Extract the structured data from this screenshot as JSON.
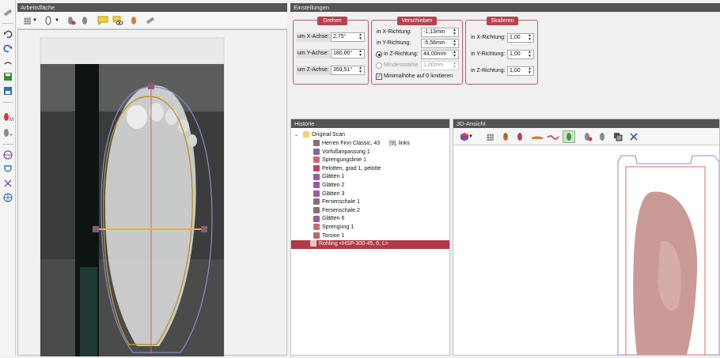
{
  "left_toolbar": {
    "icons": [
      "ruler-icon",
      "undo-icon",
      "redo-icon",
      "rotate-icon",
      "save-icon",
      "export-icon",
      "foot-m-icon",
      "foot-plus-icon",
      "compass-icon",
      "shield-icon",
      "cross-icon",
      "grid-icon"
    ],
    "foot_m_label": "M"
  },
  "workspace": {
    "title": "Arbeitsfläche",
    "toolbar": [
      "grid-icon",
      "foot-outline-icon",
      "foot-red-icon",
      "foot-gray-icon",
      "comment-icon",
      "eye-comment-icon",
      "foot-orange-icon",
      "ruler-icon"
    ]
  },
  "settings": {
    "title": "Einstellungen",
    "drehen": {
      "title": "Drehen",
      "rows": [
        {
          "label": "um X-Achse:",
          "value": "2,75°"
        },
        {
          "label": "um Y-Achse:",
          "value": "180,00°"
        },
        {
          "label": "um Z-Achse:",
          "value": "359,51°"
        }
      ]
    },
    "verschieben": {
      "title": "Verschieben",
      "rows": [
        {
          "label": "in X-Richtung:",
          "value": "-1,13mm"
        },
        {
          "label": "in Y-Richtung:",
          "value": "-5,56mm"
        },
        {
          "label": "in Z-Richtung:",
          "value": "44,00mm"
        },
        {
          "label": "Mindeststärke",
          "value": "1,00mm"
        }
      ],
      "checkbox": "Minimalhöhe auf 0 limitieren"
    },
    "skalieren": {
      "title": "Skalieren",
      "rows": [
        {
          "label": "in X-Richtung:",
          "value": "1,00"
        },
        {
          "label": "in Y-Richtung:",
          "value": "1,00"
        },
        {
          "label": "in Z-Richtung:",
          "value": "1,00"
        }
      ]
    }
  },
  "history": {
    "title": "Historie",
    "root": "Original Scan",
    "items": [
      {
        "text": "Herren Finn Classic, 43",
        "extra": "[9], links",
        "color": "#8a6f6f"
      },
      {
        "text": "Vorfußanpassung 1",
        "color": "#7a6aa8"
      },
      {
        "text": "Sprengungslinie 1",
        "color": "#c46a7a"
      },
      {
        "text": "Pelotten, grad 1, pelotte",
        "color": "#b84a5a"
      },
      {
        "text": "Glätten 1",
        "color": "#9a5aa8"
      },
      {
        "text": "Glätten 2",
        "color": "#9a5aa8"
      },
      {
        "text": "Glätten 3",
        "color": "#9a5aa8"
      },
      {
        "text": "Fersenschale 1",
        "color": "#8a6f6f"
      },
      {
        "text": "Fersenschale 2",
        "color": "#8a6f6f"
      },
      {
        "text": "Glätten 6",
        "color": "#9a5aa8"
      },
      {
        "text": "Sprengung 1",
        "color": "#c46a7a"
      },
      {
        "text": "Torsion 1",
        "color": "#b06a6a"
      },
      {
        "text": "Rohling <HSP-300-45, 6, L>",
        "color": "#e9c3c8",
        "selected": true
      }
    ]
  },
  "view3d": {
    "title": "3D-Ansicht",
    "toolbar": [
      "cube-icon",
      "grid-icon",
      "foot-color-icon",
      "foot-red-icon",
      "sole-icon",
      "wave-icon",
      "foot-green-icon",
      "foot-gray-icon",
      "foot-small-icon",
      "layers-icon",
      "tools-icon"
    ]
  },
  "colors": {
    "accent": "#b8414e",
    "titlebar": "#545454",
    "foot_model": "#c99a96"
  }
}
